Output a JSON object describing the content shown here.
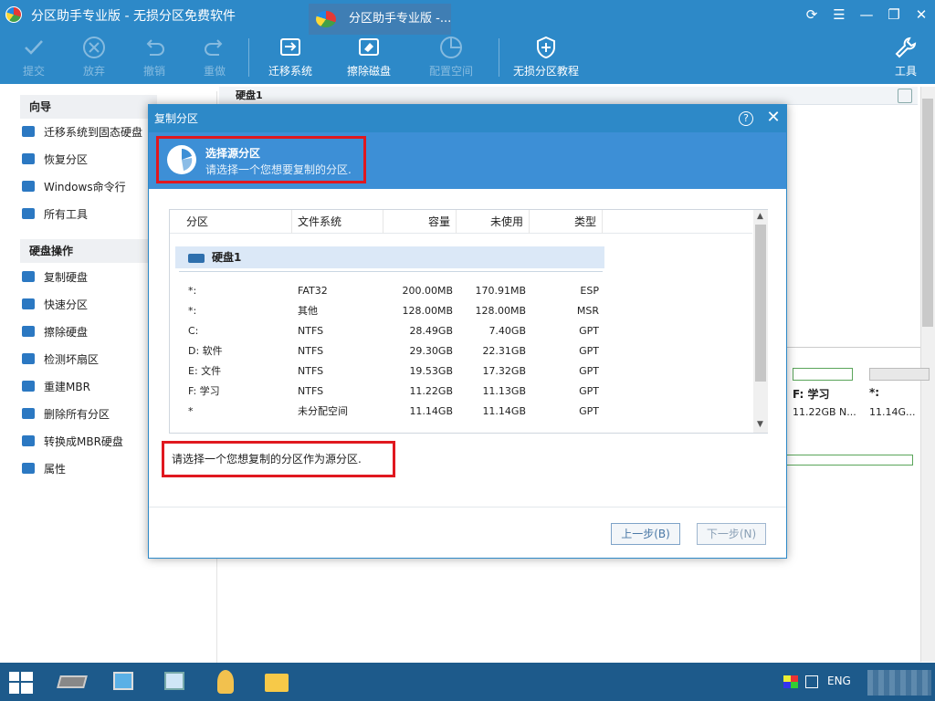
{
  "window": {
    "title": "分区助手专业版 - 无损分区免费软件"
  },
  "toolbar": {
    "commit": "提交",
    "discard": "放弃",
    "undo": "撤销",
    "redo": "重做",
    "migrate": "迁移系统",
    "wipe": "擦除磁盘",
    "config_space": "配置空间",
    "tutorial": "无损分区教程",
    "tools": "工具"
  },
  "sidebar": {
    "wizard_title": "向导",
    "wizard_items": [
      "迁移系统到固态硬盘",
      "恢复分区",
      "Windows命令行",
      "所有工具"
    ],
    "disk_ops_title": "硬盘操作",
    "disk_ops_items": [
      "复制硬盘",
      "快速分区",
      "擦除硬盘",
      "检测坏扇区",
      "重建MBR",
      "删除所有分区",
      "转换成MBR硬盘",
      "属性"
    ]
  },
  "main": {
    "disk_label": "硬盘1",
    "card_f_label": "F: 学习",
    "card_f_size": "11.22GB N...",
    "card_star_label": "*:",
    "card_star_size": "11.14G..."
  },
  "dialog": {
    "title": "复制分区",
    "help": "?",
    "close": "✕",
    "step_title": "选择源分区",
    "step_subtitle": "请选择一个您想要复制的分区.",
    "columns": [
      "分区",
      "文件系统",
      "容量",
      "未使用",
      "类型"
    ],
    "disk_name": "硬盘1",
    "rows": [
      {
        "partition": "*:",
        "fs": "FAT32",
        "capacity": "200.00MB",
        "free": "170.91MB",
        "type": "ESP"
      },
      {
        "partition": "*:",
        "fs": "其他",
        "capacity": "128.00MB",
        "free": "128.00MB",
        "type": "MSR"
      },
      {
        "partition": "C:",
        "fs": "NTFS",
        "capacity": "28.49GB",
        "free": "7.40GB",
        "type": "GPT"
      },
      {
        "partition": "D: 软件",
        "fs": "NTFS",
        "capacity": "29.30GB",
        "free": "22.31GB",
        "type": "GPT"
      },
      {
        "partition": "E: 文件",
        "fs": "NTFS",
        "capacity": "19.53GB",
        "free": "17.32GB",
        "type": "GPT"
      },
      {
        "partition": "F: 学习",
        "fs": "NTFS",
        "capacity": "11.22GB",
        "free": "11.13GB",
        "type": "GPT"
      },
      {
        "partition": "*",
        "fs": "未分配空间",
        "capacity": "11.14GB",
        "free": "11.14GB",
        "type": "GPT"
      }
    ],
    "hint": "请选择一个您想复制的分区作为源分区.",
    "back_button": "上一步(B)",
    "next_button": "下一步(N)"
  },
  "taskbar": {
    "active_app": "分区助手专业版 -...",
    "language": "ENG"
  },
  "colors": {
    "accent": "#2d89c8",
    "highlight": "#e0181f",
    "band": "#3d8fd6"
  }
}
